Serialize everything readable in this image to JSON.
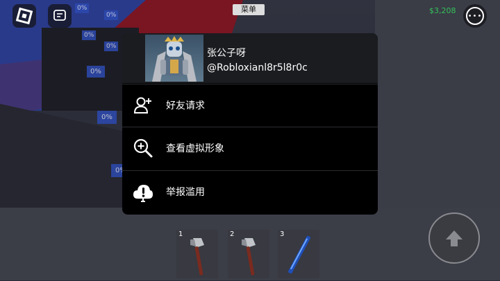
{
  "hud": {
    "menu_label": "菜单",
    "money": "$3,208",
    "more_glyph": "•••"
  },
  "world_labels": [
    "0%",
    "0%",
    "0%",
    "0%",
    "0%",
    "0%",
    "0%"
  ],
  "popup": {
    "display_name": "张公子呀",
    "username": "@Robloxianl8r5l8r0c",
    "items": [
      {
        "label": "好友请求",
        "icon": "add-friend-icon"
      },
      {
        "label": "查看虚拟形象",
        "icon": "magnify-plus-icon"
      },
      {
        "label": "举报滥用",
        "icon": "report-cloud-icon"
      }
    ]
  },
  "hotbar": [
    {
      "number": "1",
      "item": "axe"
    },
    {
      "number": "2",
      "item": "axe"
    },
    {
      "number": "3",
      "item": "blue-sword"
    }
  ],
  "colors": {
    "money": "#34c35a",
    "popup_bg": "#000000"
  }
}
